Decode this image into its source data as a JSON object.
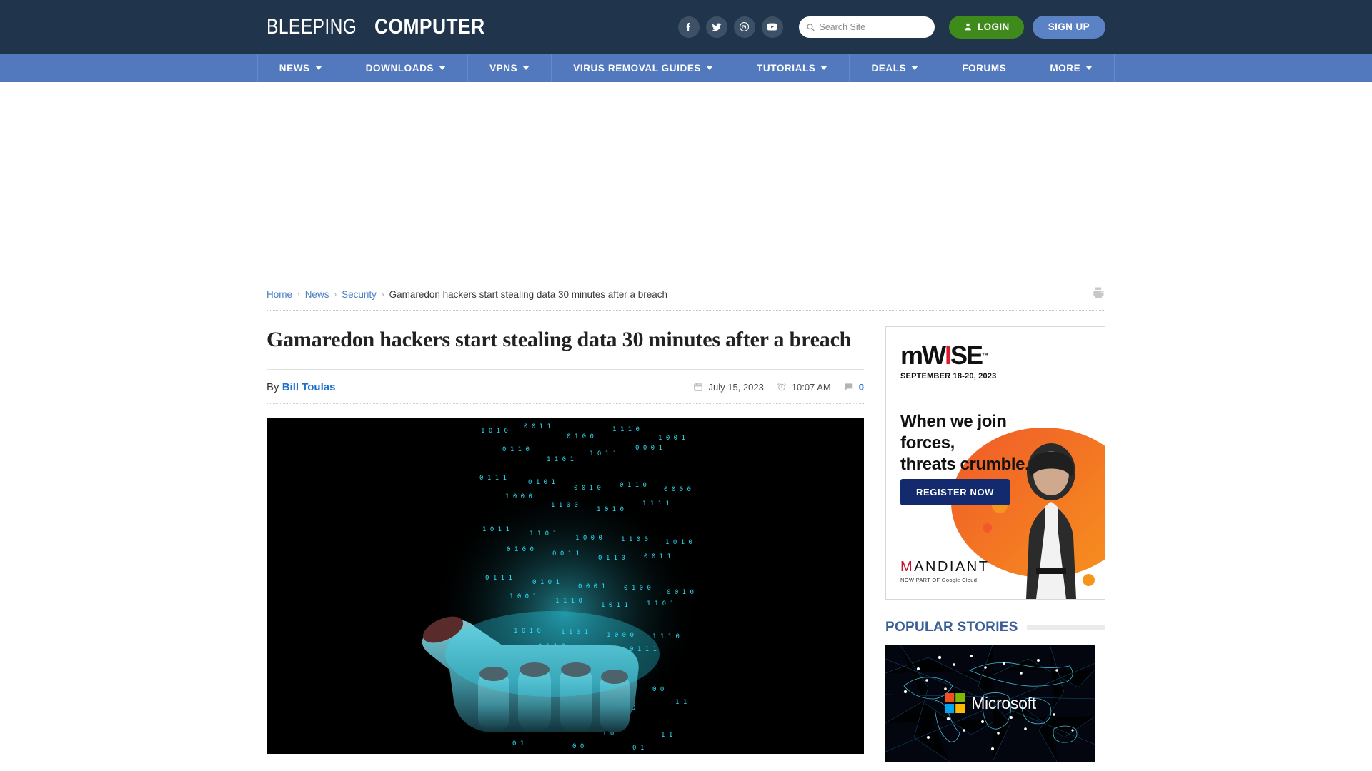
{
  "site": {
    "brand_light": "BLEEPING",
    "brand_bold": "COMPUTER",
    "header_bg": "#20344b",
    "nav_bg": "#5279bd",
    "accent_link": "#4a7dc4"
  },
  "header": {
    "social": [
      {
        "name": "facebook-icon",
        "label": "Facebook"
      },
      {
        "name": "twitter-icon",
        "label": "Twitter"
      },
      {
        "name": "mastodon-icon",
        "label": "Mastodon"
      },
      {
        "name": "youtube-icon",
        "label": "YouTube"
      }
    ],
    "search": {
      "placeholder": "Search Site",
      "value": ""
    },
    "login_label": "LOGIN",
    "signup_label": "SIGN UP"
  },
  "nav": {
    "items": [
      {
        "label": "NEWS",
        "has_caret": true
      },
      {
        "label": "DOWNLOADS",
        "has_caret": true
      },
      {
        "label": "VPNS",
        "has_caret": true
      },
      {
        "label": "VIRUS REMOVAL GUIDES",
        "has_caret": true
      },
      {
        "label": "TUTORIALS",
        "has_caret": true
      },
      {
        "label": "DEALS",
        "has_caret": true
      },
      {
        "label": "FORUMS",
        "has_caret": false
      },
      {
        "label": "MORE",
        "has_caret": true
      }
    ]
  },
  "breadcrumb": {
    "items": [
      {
        "label": "Home",
        "link": true
      },
      {
        "label": "News",
        "link": true
      },
      {
        "label": "Security",
        "link": true
      },
      {
        "label": "Gamaredon hackers start stealing data 30 minutes after a breach",
        "link": false
      }
    ],
    "separator": "›",
    "print_label": "Print"
  },
  "article": {
    "title": "Gamaredon hackers start stealing data 30 minutes after a breach",
    "by_label": "By",
    "author": "Bill Toulas",
    "date": "July 15, 2023",
    "time": "10:07 AM",
    "comment_count": "0",
    "hero_alt": "Hand catching falling binary digits"
  },
  "sidebar": {
    "ad": {
      "logo_m": "m",
      "logo_w": "W",
      "logo_bolt": "I",
      "logo_se": "SE",
      "logo_tm": "™",
      "event_date": "SEPTEMBER 18-20, 2023",
      "headline_line1": "When we join forces,",
      "headline_line2": "threats crumble.",
      "cta_label": "REGISTER NOW",
      "sponsor_m": "M",
      "sponsor_rest": "ANDIANT",
      "sponsor_tm": "˙",
      "sponsor_sub": "NOW PART OF Google Cloud"
    },
    "popular": {
      "title": "POPULAR STORIES",
      "thumb_label": "Microsoft"
    }
  }
}
